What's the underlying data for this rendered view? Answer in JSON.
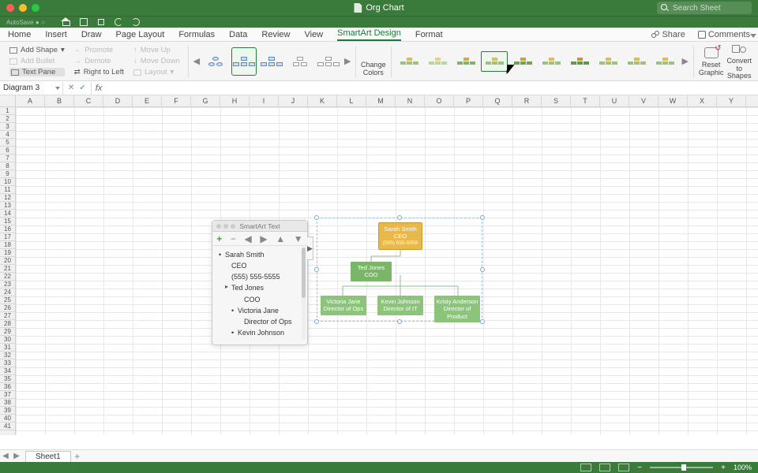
{
  "window": {
    "title": "Org Chart",
    "search_placeholder": "Search Sheet"
  },
  "tabs": {
    "items": [
      "Home",
      "Insert",
      "Draw",
      "Page Layout",
      "Formulas",
      "Data",
      "Review",
      "View",
      "SmartArt Design",
      "Format"
    ],
    "active_index": 8,
    "share": "Share",
    "comments": "Comments"
  },
  "ribbon": {
    "create": {
      "add_shape": "Add Shape",
      "add_bullet": "Add Bullet",
      "text_pane": "Text Pane",
      "promote": "Promote",
      "demote": "Demote",
      "right_to_left": "Right to Left",
      "move_up": "Move Up",
      "move_down": "Move Down",
      "layout": "Layout"
    },
    "change_colors": "Change Colors",
    "reset_graphic": "Reset Graphic",
    "convert_to_shapes": "Convert to Shapes"
  },
  "formula_bar": {
    "name_box": "Diagram 3",
    "cancel": "✕",
    "confirm": "✓",
    "fx": "fx",
    "value": ""
  },
  "columns": [
    "A",
    "B",
    "C",
    "D",
    "E",
    "F",
    "G",
    "H",
    "I",
    "J",
    "K",
    "L",
    "M",
    "N",
    "O",
    "P",
    "Q",
    "R",
    "S",
    "T",
    "U",
    "V",
    "W",
    "X",
    "Y"
  ],
  "text_pane": {
    "title": "SmartArt Text",
    "items": [
      {
        "level": "l1",
        "text": "Sarah Smith"
      },
      {
        "level": "l2",
        "text": "CEO"
      },
      {
        "level": "l2",
        "text": "(555) 555-5555"
      },
      {
        "level": "l2b",
        "text": "Ted Jones"
      },
      {
        "level": "l4",
        "text": "COO"
      },
      {
        "level": "l3",
        "text": "Victoria Jane"
      },
      {
        "level": "l4",
        "text": "Director of Ops"
      },
      {
        "level": "l3",
        "text": "Kevin Johnson"
      }
    ]
  },
  "org_chart": {
    "ceo": {
      "name": "Sarah Smith",
      "title": "CEO",
      "phone": "(555) 555-5555"
    },
    "coo": {
      "name": "Ted Jones",
      "title": "COO"
    },
    "dir1": {
      "name": "Victoria Jane",
      "title": "Director of Ops"
    },
    "dir2": {
      "name": "Kevin Johnson",
      "title": "Director of IT"
    },
    "dir3": {
      "name": "Kristy Anderson",
      "title": "Director of Product"
    }
  },
  "sheet_tabs": {
    "active": "Sheet1"
  },
  "status": {
    "zoom": "100%"
  }
}
